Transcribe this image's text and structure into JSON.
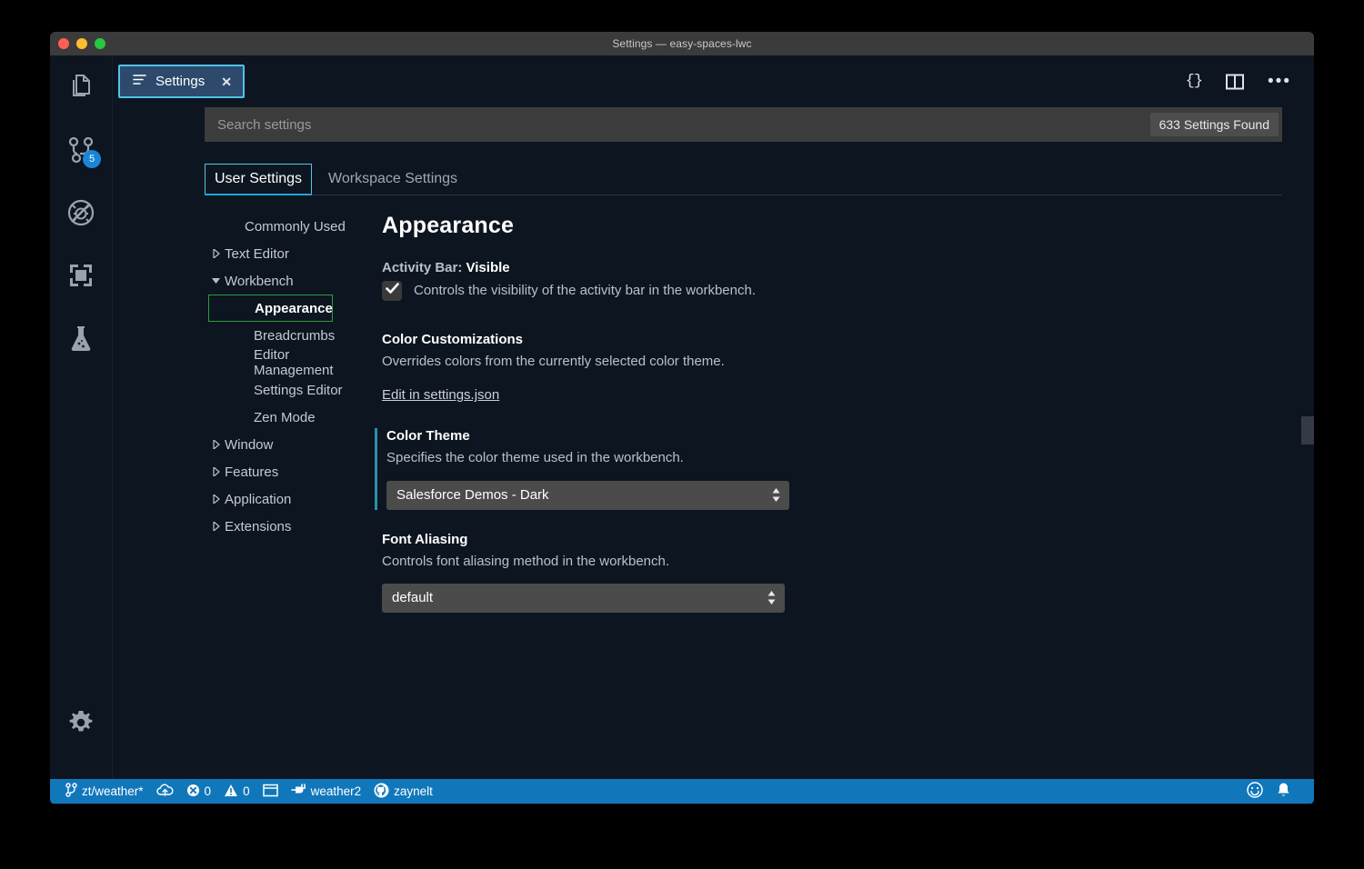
{
  "window": {
    "title": "Settings — easy-spaces-lwc",
    "traffic_lights": [
      "close-button",
      "minimize-button",
      "maximize-button"
    ]
  },
  "activity_bar": {
    "items": [
      {
        "icon": "files-explorer-icon",
        "name": "explorer"
      },
      {
        "icon": "source-control-icon",
        "name": "source-control",
        "badge": "5"
      },
      {
        "icon": "run-debug-disabled-icon",
        "name": "run-and-debug"
      },
      {
        "icon": "extensions-icon",
        "name": "extensions"
      },
      {
        "icon": "beaker-test-icon",
        "name": "testing"
      }
    ],
    "bottom": {
      "icon": "gear-icon",
      "name": "manage-settings"
    }
  },
  "tabs": {
    "active": {
      "icon": "settings-lines-icon",
      "label": "Settings",
      "close": "✕"
    }
  },
  "editor_toolbar": {
    "open_json_label": "{}",
    "split_editor_label": "split-editor",
    "more_actions_label": "•••"
  },
  "search": {
    "placeholder": "Search settings",
    "value": "",
    "results_badge": "633 Settings Found"
  },
  "scope_tabs": [
    {
      "label": "User Settings",
      "active": true
    },
    {
      "label": "Workspace Settings",
      "active": false
    }
  ],
  "toc": {
    "items": [
      {
        "label": "Commonly Used",
        "level": 0,
        "arrow": "none",
        "selected": false
      },
      {
        "label": "Text Editor",
        "level": 0,
        "arrow": "collapsed",
        "selected": false
      },
      {
        "label": "Workbench",
        "level": 0,
        "arrow": "expanded",
        "selected": false
      },
      {
        "label": "Appearance",
        "level": 1,
        "arrow": "none",
        "selected": true
      },
      {
        "label": "Breadcrumbs",
        "level": 1,
        "arrow": "none",
        "selected": false
      },
      {
        "label": "Editor Management",
        "level": 1,
        "arrow": "none",
        "selected": false
      },
      {
        "label": "Settings Editor",
        "level": 1,
        "arrow": "none",
        "selected": false
      },
      {
        "label": "Zen Mode",
        "level": 1,
        "arrow": "none",
        "selected": false
      },
      {
        "label": "Window",
        "level": 0,
        "arrow": "collapsed",
        "selected": false
      },
      {
        "label": "Features",
        "level": 0,
        "arrow": "collapsed",
        "selected": false
      },
      {
        "label": "Application",
        "level": 0,
        "arrow": "collapsed",
        "selected": false
      },
      {
        "label": "Extensions",
        "level": 0,
        "arrow": "collapsed",
        "selected": false
      }
    ]
  },
  "main": {
    "page_title": "Appearance",
    "settings": {
      "activity_bar_visible": {
        "title_prefix": "Activity Bar: ",
        "title_key": "Visible",
        "description": "Controls the visibility of the activity bar in the workbench.",
        "checked": true
      },
      "color_customizations": {
        "title": "Color Customizations",
        "description": "Overrides colors from the currently selected color theme.",
        "link": "Edit in settings.json"
      },
      "color_theme": {
        "title": "Color Theme",
        "description": "Specifies the color theme used in the workbench.",
        "value": "Salesforce Demos - Dark",
        "modified": true
      },
      "font_aliasing": {
        "title": "Font Aliasing",
        "description": "Controls font aliasing method in the workbench.",
        "value": "default",
        "modified": false
      }
    }
  },
  "status_bar": {
    "branch": "zt/weather*",
    "sync_icon": "cloud-sync-icon",
    "errors": "0",
    "warnings": "0",
    "terminal_icon": "window-icon",
    "org_label": "weather2",
    "github_user": "zaynelt",
    "feedback_icon": "smiley-icon",
    "bell_icon": "bell-icon"
  },
  "colors": {
    "background": "#0d1520",
    "status_bar": "#1177bb",
    "accent_cyan": "#4fc3e8",
    "selected_green": "#2a9d3a",
    "modified_teal": "#2d8fad",
    "badge_blue": "#1a85d6"
  }
}
